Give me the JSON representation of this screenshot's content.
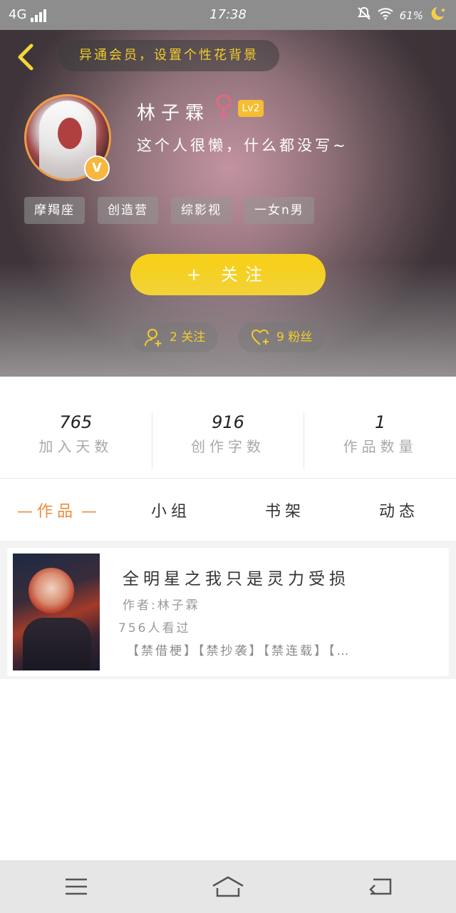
{
  "status": {
    "network": "4G",
    "time": "17:38",
    "battery": "61%",
    "icons": [
      "signal-icon",
      "mute-icon",
      "wifi-icon",
      "battery-icon",
      "moon-icon"
    ]
  },
  "header": {
    "notice": "异通会员，设置个性花背景"
  },
  "profile": {
    "name": "林子霖",
    "level": "Lv2",
    "verified_badge": "V",
    "bio": "这个人很懒，什么都没写~",
    "tags": [
      "摩羯座",
      "创造营",
      "综影视",
      "一女n男"
    ],
    "follow_label": "+ 关注",
    "following_text": "2 关注",
    "fans_text": "9 粉丝"
  },
  "stats": [
    {
      "value": "765",
      "label": "加入天数"
    },
    {
      "value": "916",
      "label": "创作字数"
    },
    {
      "value": "1",
      "label": "作品数量"
    }
  ],
  "tabs": [
    "作品",
    "小组",
    "书架",
    "动态"
  ],
  "work": {
    "title": "全明星之我只是灵力受损",
    "author": "作者:林子霖",
    "views": "756人看过",
    "tags": "【禁借梗】【禁抄袭】【禁连载】【…"
  },
  "colors": {
    "accent": "#f6d01a",
    "active_tab": "#ee8b3b",
    "gold_text": "#f2cd2a"
  }
}
